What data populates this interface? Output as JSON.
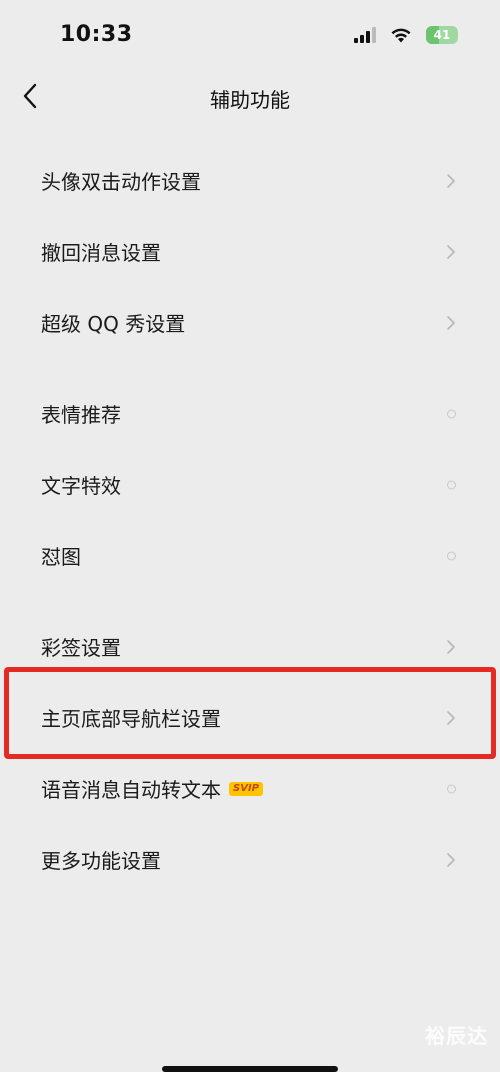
{
  "status_bar": {
    "time": "10:33",
    "battery_level": "41",
    "battery_fraction": 0.41,
    "signal_icon": "signal-icon",
    "wifi_icon": "wifi-icon"
  },
  "nav": {
    "title": "辅助功能",
    "back_icon": "chevron-left-icon"
  },
  "settings": {
    "groups": [
      {
        "items": [
          {
            "label": "头像双击动作设置",
            "accessory": "chevron-right-icon"
          },
          {
            "label": "撤回消息设置",
            "accessory": "chevron-right-icon"
          },
          {
            "label": "超级 QQ 秀设置",
            "accessory": "chevron-right-icon"
          }
        ]
      },
      {
        "items": [
          {
            "label": "表情推荐",
            "accessory": "circle-icon"
          },
          {
            "label": "文字特效",
            "accessory": "circle-icon"
          },
          {
            "label": "怼图",
            "accessory": "circle-icon"
          }
        ]
      },
      {
        "items": [
          {
            "label": "彩签设置",
            "accessory": "chevron-right-icon"
          },
          {
            "label": "主页底部导航栏设置",
            "accessory": "chevron-right-icon",
            "highlighted": true
          },
          {
            "label": "语音消息自动转文本",
            "badge": "SVIP",
            "accessory": "circle-icon"
          },
          {
            "label": "更多功能设置",
            "accessory": "chevron-right-icon"
          }
        ]
      }
    ]
  },
  "colors": {
    "background": "#ececec",
    "highlight_border": "#e52a24",
    "battery": "#6cc46f",
    "svip_badge": "#ffc400"
  },
  "watermark": "裕辰达"
}
